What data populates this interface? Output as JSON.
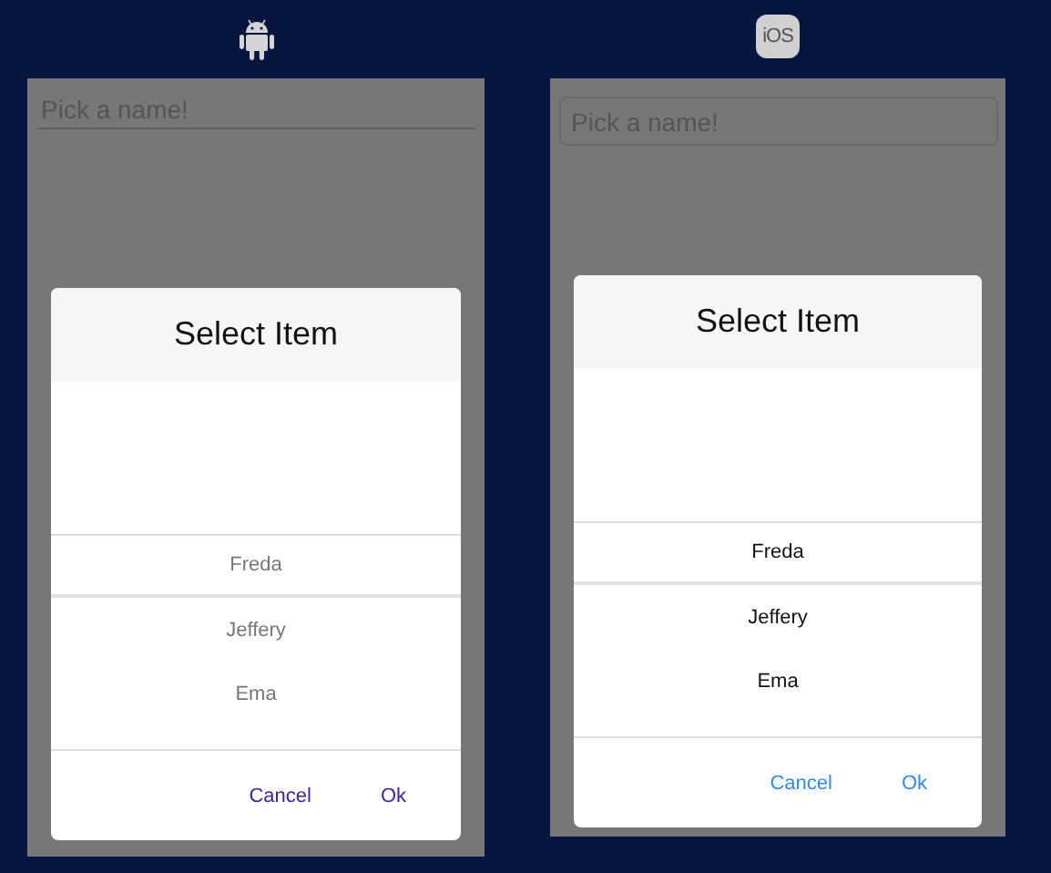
{
  "platforms": [
    {
      "kind": "android",
      "field": {
        "placeholder": "Pick a name!"
      },
      "dialog": {
        "title": "Select Item",
        "items": [
          {
            "label": "Freda",
            "selected": true
          },
          {
            "label": "Jeffery",
            "selected": false
          },
          {
            "label": "Ema",
            "selected": false
          }
        ],
        "buttons": [
          "Cancel",
          "Ok"
        ]
      }
    },
    {
      "kind": "ios",
      "badge": "iOS",
      "field": {
        "placeholder": "Pick a name!"
      },
      "dialog": {
        "title": "Select Item",
        "items": [
          {
            "label": "Freda",
            "selected": true
          },
          {
            "label": "Jeffery",
            "selected": false
          },
          {
            "label": "Ema",
            "selected": false
          }
        ],
        "buttons": [
          "Cancel",
          "Ok"
        ]
      }
    }
  ]
}
